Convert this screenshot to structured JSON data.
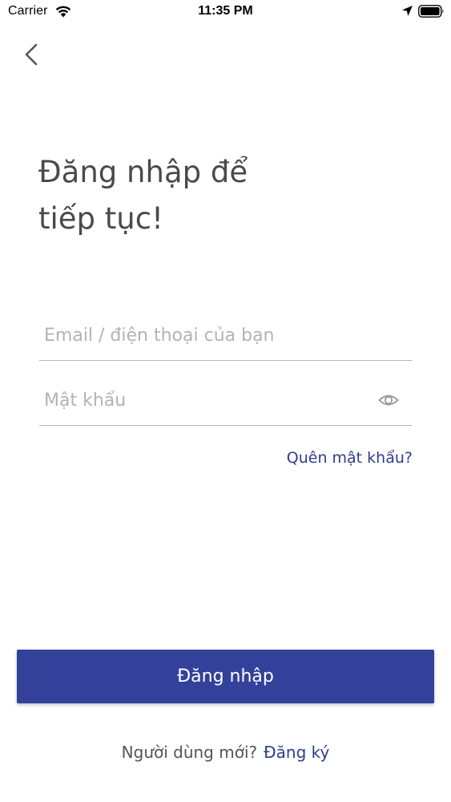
{
  "status_bar": {
    "carrier": "Carrier",
    "time": "11:35 PM",
    "icons": [
      "wifi-icon",
      "location-arrow-icon",
      "battery-icon"
    ]
  },
  "nav": {
    "back_icon": "chevron-left-icon"
  },
  "title": "Đăng nhập để\ntiếp tục!",
  "form": {
    "email_placeholder": "Email / điện thoại của bạn",
    "email_value": "",
    "password_placeholder": "Mật khẩu",
    "password_value": "",
    "password_toggle_icon": "eye-icon",
    "forgot_password": "Quên mật khẩu?"
  },
  "actions": {
    "login_label": "Đăng nhập",
    "signup_prompt": "Người dùng mới?",
    "signup_link": "Đăng ký"
  },
  "colors": {
    "primary": "#33419a",
    "link": "#2f3d8c",
    "title_text": "#4a4a4a",
    "placeholder": "#b3b3b3",
    "divider": "#b7b7b7"
  }
}
